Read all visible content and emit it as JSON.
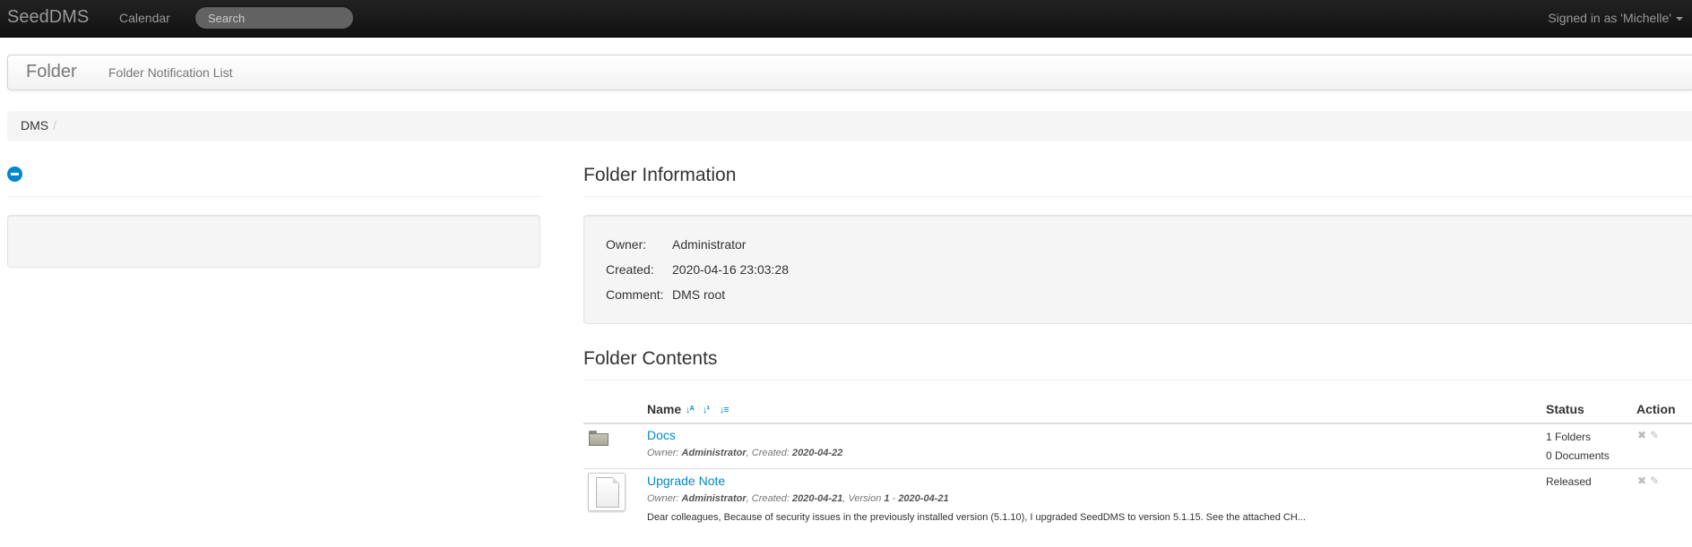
{
  "navbar": {
    "brand": "SeedDMS",
    "calendar_label": "Calendar",
    "search_placeholder": "Search",
    "signed_in": "Signed in as 'Michelle'"
  },
  "subnav": {
    "brand": "Folder",
    "notification_link": "Folder Notification List"
  },
  "breadcrumb": {
    "items": [
      "DMS"
    ],
    "divider": "/"
  },
  "folder_info": {
    "title": "Folder Information",
    "owner_label": "Owner:",
    "owner_value": "Administrator",
    "created_label": "Created:",
    "created_value": "2020-04-16 23:03:28",
    "comment_label": "Comment:",
    "comment_value": "DMS root"
  },
  "folder_contents": {
    "title": "Folder Contents",
    "columns": {
      "name": "Name",
      "status": "Status",
      "action": "Action"
    },
    "sort_icons": [
      "sort-alpha-icon",
      "sort-numeric-icon",
      "sort-amount-icon"
    ],
    "rows": [
      {
        "type": "folder",
        "name": "Docs",
        "owner_label": "Owner:",
        "owner": "Administrator",
        "created_label": "Created:",
        "created": "2020-04-22",
        "status_line1": "1 Folders",
        "status_line2": "0 Documents"
      },
      {
        "type": "document",
        "name": "Upgrade Note",
        "owner_label": "Owner:",
        "owner": "Administrator",
        "created_label": "Created:",
        "created": "2020-04-21",
        "version_label": "Version",
        "version": "1",
        "version_date": "2020-04-21",
        "comment": "Dear colleagues, Because of security issues in the previously installed version (5.1.10), I upgraded SeedDMS to version 5.1.15. See the attached CH...",
        "status_line1": "Released"
      }
    ]
  },
  "colors": {
    "link": "#0088cc",
    "navbar_bg": "#1b1b1b",
    "well_bg": "#f5f5f5"
  }
}
